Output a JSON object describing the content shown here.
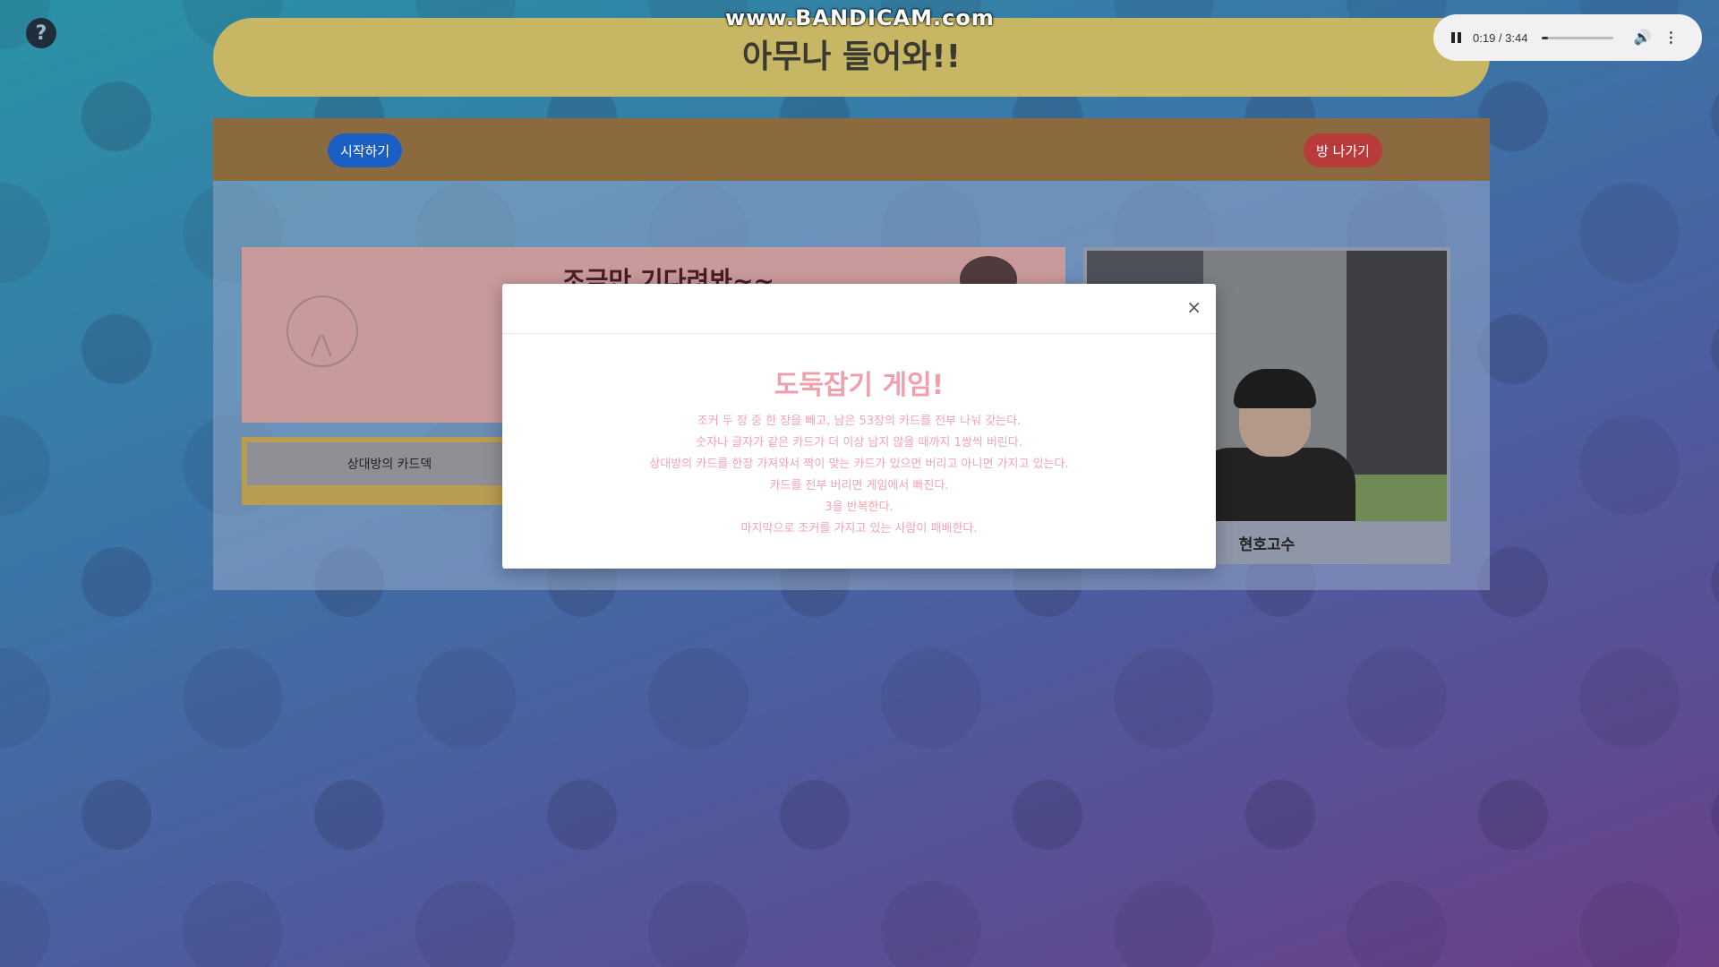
{
  "watermark": "www.BANDICAM.com",
  "help": {
    "symbol": "?"
  },
  "header": {
    "title": "아무나 들어와!!"
  },
  "media_player": {
    "time": "0:19 / 3:44",
    "progress_fraction": 0.086
  },
  "room": {
    "start_label": "시작하기",
    "leave_label": "방 나가기",
    "waiting_text": "조금만 기다려봐~~",
    "opponent_deck_label": "상대방의 카드덱"
  },
  "video": {
    "player_name": "현호고수"
  },
  "modal": {
    "title": "도둑잡기 게임!",
    "close_symbol": "×",
    "rules": [
      "조커 두 장 중 한 장을 빼고, 남은 53장의 카드를 전부 나눠 갖는다.",
      "숫자나 글자가 같은 카드가 더 이상 남지 않을 때까지 1쌍씩 버린다.",
      "상대방의 카드를 한장 가져와서 짝이 맞는 카드가 있으면 버리고 아니면 가지고 있는다.",
      "카드를 전부 버리면 게임에서 빠진다.",
      "3을 반복한다.",
      "마지막으로 조커를 가지고 있는 사람이 패배한다."
    ]
  }
}
